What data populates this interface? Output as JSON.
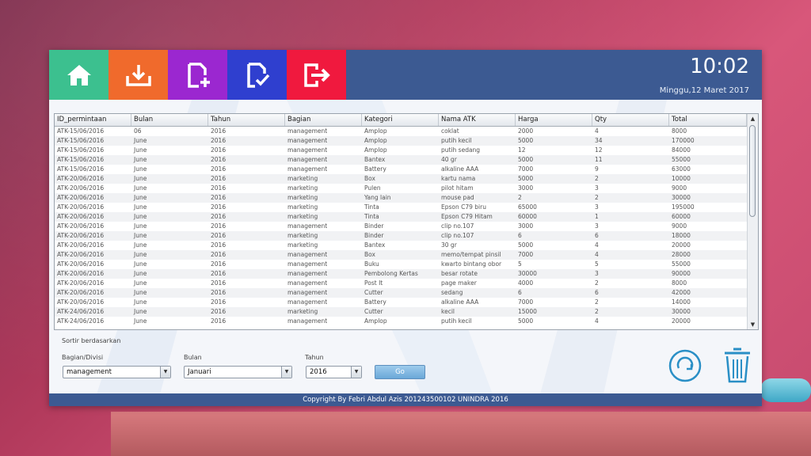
{
  "toolbar": {
    "tiles": [
      {
        "icon": "home-icon",
        "color": "#3cc08f"
      },
      {
        "icon": "download-icon",
        "color": "#f06a2c"
      },
      {
        "icon": "add-document-icon",
        "color": "#9b27d0"
      },
      {
        "icon": "verify-document-icon",
        "color": "#2f3fcf"
      },
      {
        "icon": "exit-icon",
        "color": "#f0193e"
      }
    ],
    "clock": "10:02",
    "date": "Minggu,12 Maret 2017"
  },
  "table": {
    "columns": [
      "ID_permintaan",
      "Bulan",
      "Tahun",
      "Bagian",
      "Kategori",
      "Nama ATK",
      "Harga",
      "Qty",
      "Total"
    ],
    "rows": [
      [
        "ATK-15/06/2016",
        "06",
        "2016",
        "management",
        "Amplop",
        "coklat",
        "2000",
        "4",
        "8000"
      ],
      [
        "ATK-15/06/2016",
        "June",
        "2016",
        "management",
        "Amplop",
        "putih kecil",
        "5000",
        "34",
        "170000"
      ],
      [
        "ATK-15/06/2016",
        "June",
        "2016",
        "management",
        "Amplop",
        "putih sedang",
        "12",
        "12",
        "84000"
      ],
      [
        "ATK-15/06/2016",
        "June",
        "2016",
        "management",
        "Bantex",
        "40 gr",
        "5000",
        "11",
        "55000"
      ],
      [
        "ATK-15/06/2016",
        "June",
        "2016",
        "management",
        "Battery",
        "alkaline AAA",
        "7000",
        "9",
        "63000"
      ],
      [
        "ATK-20/06/2016",
        "June",
        "2016",
        "marketing",
        "Box",
        "kartu nama",
        "5000",
        "2",
        "10000"
      ],
      [
        "ATK-20/06/2016",
        "June",
        "2016",
        "marketing",
        "Pulen",
        "pilot hitam",
        "3000",
        "3",
        "9000"
      ],
      [
        "ATK-20/06/2016",
        "June",
        "2016",
        "marketing",
        "Yang lain",
        "mouse pad",
        "2",
        "2",
        "30000"
      ],
      [
        "ATK-20/06/2016",
        "June",
        "2016",
        "marketing",
        "Tinta",
        "Epson C79 biru",
        "65000",
        "3",
        "195000"
      ],
      [
        "ATK-20/06/2016",
        "June",
        "2016",
        "marketing",
        "Tinta",
        "Epson C79 Hitam",
        "60000",
        "1",
        "60000"
      ],
      [
        "ATK-20/06/2016",
        "June",
        "2016",
        "management",
        "Binder",
        "clip no.107",
        "3000",
        "3",
        "9000"
      ],
      [
        "ATK-20/06/2016",
        "June",
        "2016",
        "marketing",
        "Binder",
        "clip no.107",
        "6",
        "6",
        "18000"
      ],
      [
        "ATK-20/06/2016",
        "June",
        "2016",
        "marketing",
        "Bantex",
        "30 gr",
        "5000",
        "4",
        "20000"
      ],
      [
        "ATK-20/06/2016",
        "June",
        "2016",
        "management",
        "Box",
        "memo/tempat pinsil",
        "7000",
        "4",
        "28000"
      ],
      [
        "ATK-20/06/2016",
        "June",
        "2016",
        "management",
        "Buku",
        "kwarto bintang obor",
        "5",
        "5",
        "55000"
      ],
      [
        "ATK-20/06/2016",
        "June",
        "2016",
        "management",
        "Pembolong Kertas",
        "besar rotate",
        "30000",
        "3",
        "90000"
      ],
      [
        "ATK-20/06/2016",
        "June",
        "2016",
        "management",
        "Post It",
        "page maker",
        "4000",
        "2",
        "8000"
      ],
      [
        "ATK-20/06/2016",
        "June",
        "2016",
        "management",
        "Cutter",
        "sedang",
        "6",
        "6",
        "42000"
      ],
      [
        "ATK-20/06/2016",
        "June",
        "2016",
        "management",
        "Battery",
        "alkaline AAA",
        "7000",
        "2",
        "14000"
      ],
      [
        "ATK-24/06/2016",
        "June",
        "2016",
        "marketing",
        "Cutter",
        "kecil",
        "15000",
        "2",
        "30000"
      ],
      [
        "ATK-24/06/2016",
        "June",
        "2016",
        "management",
        "Amplop",
        "putih kecil",
        "5000",
        "4",
        "20000"
      ]
    ]
  },
  "filter": {
    "sort_label": "Sortir berdasarkan",
    "divisi_label": "Bagian/Divisi",
    "divisi_value": "management",
    "bulan_label": "Bulan",
    "bulan_value": "Januari",
    "tahun_label": "Tahun",
    "tahun_value": "2016",
    "go_label": "Go"
  },
  "actions": {
    "refresh_icon": "refresh-icon",
    "delete_icon": "trash-icon",
    "accent": "#2a8fc6"
  },
  "footer": {
    "copyright": "Copyright By Febri Abdul Azis 201243500102 UNINDRA 2016"
  }
}
